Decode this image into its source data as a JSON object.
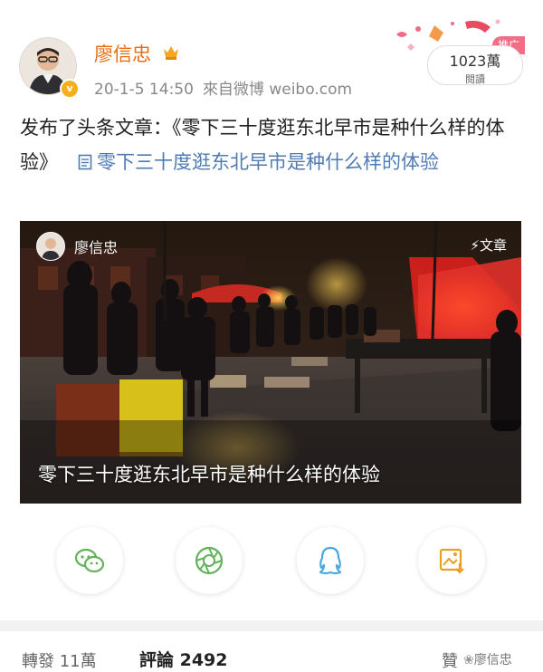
{
  "post": {
    "author": "廖信忠",
    "timestamp": "20-1-5 14:50",
    "source": "來自微博 weibo.com",
    "read_count": "1023萬",
    "read_label": "閱讀",
    "promo_badge": "推广",
    "text_prefix": "发布了头条文章：《零下三十度逛东北早市是种什么样的体验》",
    "link_text": "零下三十度逛东北早市是种什么样的体验"
  },
  "article_card": {
    "author": "廖信忠",
    "type_label": "文章",
    "title": "零下三十度逛东北早市是种什么样的体验"
  },
  "share_buttons": [
    {
      "icon": "wechat-icon",
      "color": "#62b35a"
    },
    {
      "icon": "moments-icon",
      "color": "#62b35a"
    },
    {
      "icon": "qq-icon",
      "color": "#4aa8e0"
    },
    {
      "icon": "save-image-icon",
      "color": "#e8a020"
    }
  ],
  "stats": {
    "repost": "轉發 11萬",
    "comment": "評論 2492",
    "like": "贊",
    "watermark": "廖信忠"
  },
  "colors": {
    "author": "#e86b11",
    "link": "#4f7bb4",
    "meta": "#888888"
  }
}
